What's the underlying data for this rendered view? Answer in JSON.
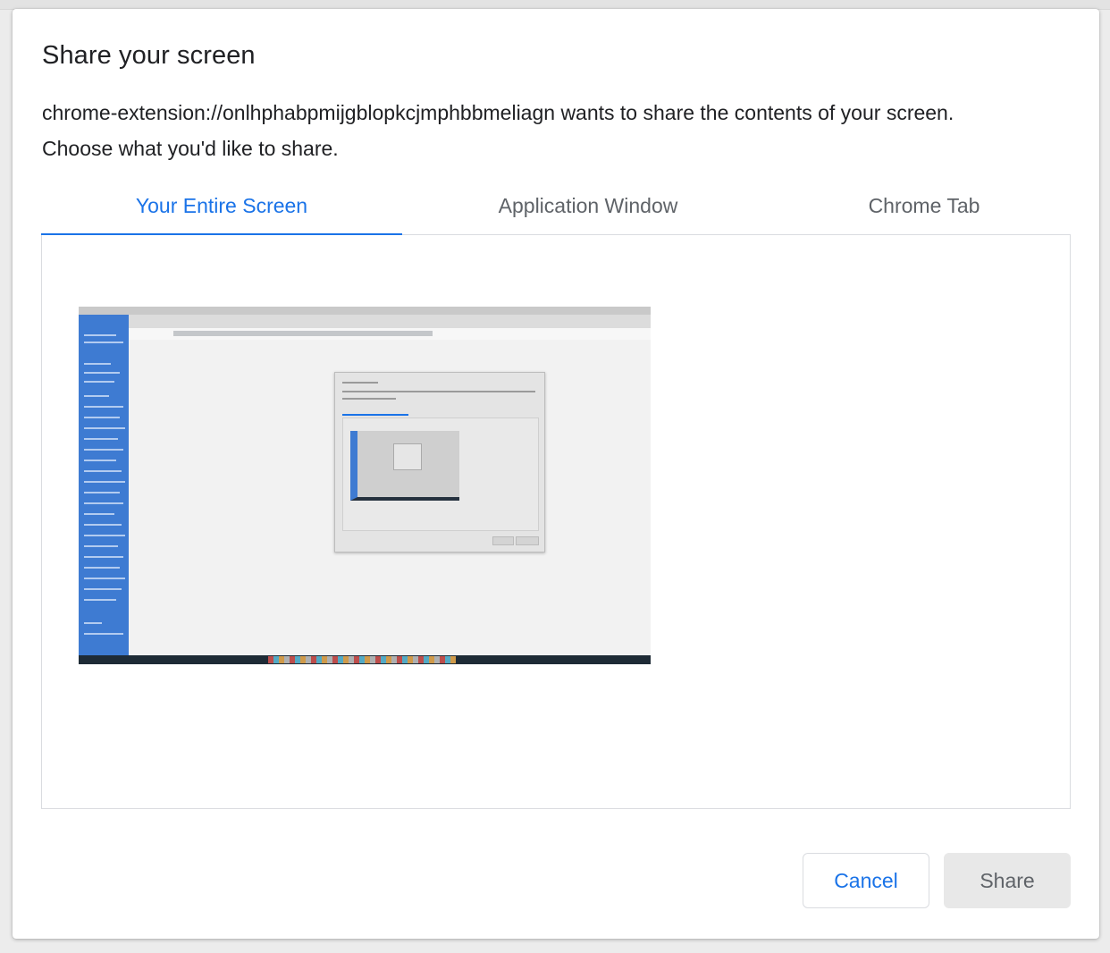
{
  "dialog": {
    "title": "Share your screen",
    "description_line1": "chrome-extension://onlhphabpmijgblopkcjmphbbmeliagn wants to share the contents of your screen.",
    "description_line2": "Choose what you'd like to share."
  },
  "tabs": [
    {
      "label": "Your Entire Screen",
      "active": true
    },
    {
      "label": "Application Window",
      "active": false
    },
    {
      "label": "Chrome Tab",
      "active": false
    }
  ],
  "buttons": {
    "cancel_label": "Cancel",
    "share_label": "Share",
    "share_enabled": false
  },
  "colors": {
    "accent": "#1a73e8",
    "text_primary": "#202124",
    "text_secondary": "#5f6368",
    "divider": "#dadce0",
    "disabled_button_bg": "#e8e8e8"
  },
  "icons": {
    "screen_thumbnail": "screen-preview-thumbnail"
  }
}
